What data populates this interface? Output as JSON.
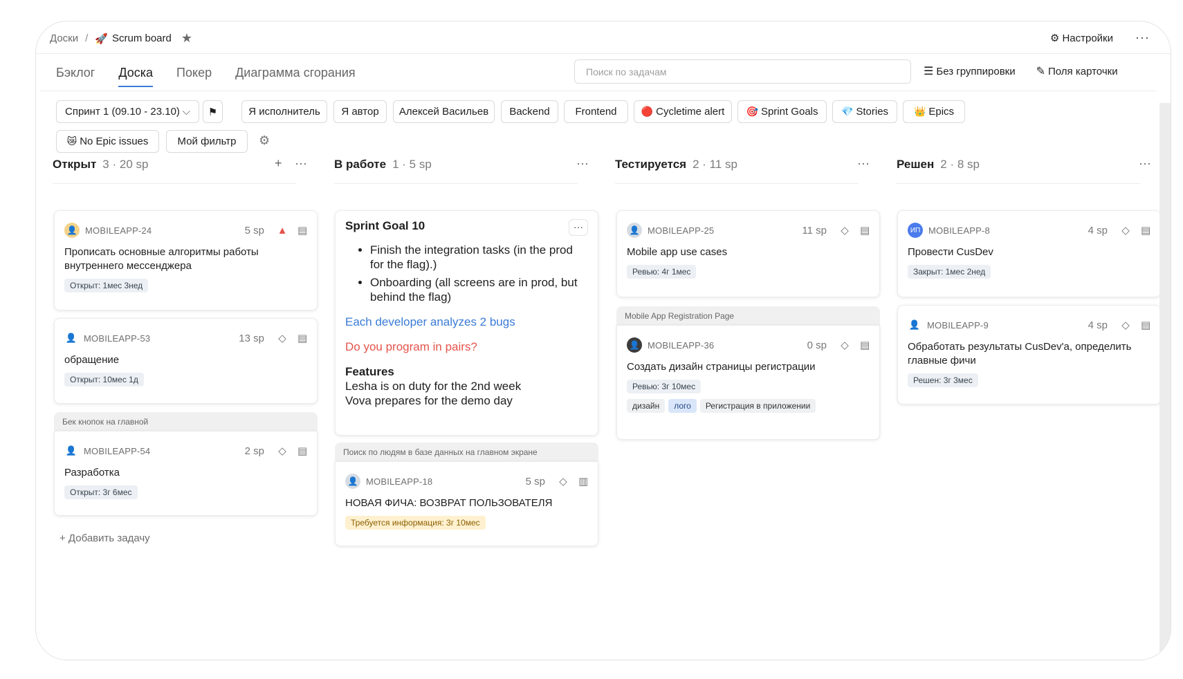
{
  "breadcrumb": {
    "root": "Доски",
    "separator": "/",
    "board_emoji": "🚀",
    "board_name": "Scrum board"
  },
  "header": {
    "settings_label": "Настройки",
    "more": "···"
  },
  "tabs": [
    {
      "label": "Бэклог",
      "active": false
    },
    {
      "label": "Доска",
      "active": true
    },
    {
      "label": "Покер",
      "active": false
    },
    {
      "label": "Диаграмма сгорания",
      "active": false
    }
  ],
  "search": {
    "placeholder": "Поиск по задачам"
  },
  "toolbar": {
    "grouping_label": "Без группировки",
    "card_fields_label": "Поля карточки"
  },
  "filters": {
    "sprint": "Спринт 1 (09.10 - 23.10)",
    "chips": [
      {
        "emoji": "",
        "label": "Я исполнитель"
      },
      {
        "emoji": "",
        "label": "Я автор"
      },
      {
        "emoji": "",
        "label": "Алексей Васильев"
      },
      {
        "emoji": "",
        "label": "Backend"
      },
      {
        "emoji": "",
        "label": "Frontend"
      },
      {
        "emoji": "🔴",
        "label": "Cycletime alert"
      },
      {
        "emoji": "🎯",
        "label": "Sprint Goals"
      },
      {
        "emoji": "💎",
        "label": "Stories"
      },
      {
        "emoji": "👑",
        "label": "Epics"
      },
      {
        "emoji": "😿",
        "label": "No Epic issues"
      },
      {
        "emoji": "",
        "label": "Мой фильтр"
      }
    ]
  },
  "columns": [
    {
      "title": "Открыт",
      "meta": "3 · 20 sp"
    },
    {
      "title": "В работе",
      "meta": "1 · 5 sp"
    },
    {
      "title": "Тестируется",
      "meta": "2 · 11 sp"
    },
    {
      "title": "Решен",
      "meta": "2 · 8 sp"
    }
  ],
  "cards": {
    "c24": {
      "key": "MOBILEAPP-24",
      "sp": "5 sp",
      "title": "Прописать основные алгоритмы работы внутреннего мессенджера",
      "badge": "Открыт: 1мес 3нед"
    },
    "c53": {
      "key": "MOBILEAPP-53",
      "sp": "13 sp",
      "title": "обращение",
      "badge": "Открыт: 10мес 1д"
    },
    "c54": {
      "group": "Бек кнопок на главной",
      "key": "MOBILEAPP-54",
      "sp": "2 sp",
      "title": "Разработка",
      "badge": "Открыт: 3г 6мес"
    },
    "c18": {
      "group": "Поиск по людям в базе данных на главном экране",
      "key": "MOBILEAPP-18",
      "sp": "5 sp",
      "title": "НОВАЯ ФИЧА: ВОЗВРАТ ПОЛЬЗОВАТЕЛЯ",
      "badge": "Требуется информация: 3г 10мес"
    },
    "c25": {
      "key": "MOBILEAPP-25",
      "sp": "11 sp",
      "title": "Mobile app use cases",
      "badge": "Ревью: 4г 1мес"
    },
    "c36": {
      "group": "Mobile App Registration Page",
      "key": "MOBILEAPP-36",
      "sp": "0 sp",
      "title": "Создать дизайн страницы регистрации",
      "badge": "Ревью: 3г 10мес",
      "tags": [
        "дизайн",
        "лого",
        "Регистрация в приложении"
      ]
    },
    "c8": {
      "key": "MOBILEAPP-8",
      "avatar": "ИП",
      "sp": "4 sp",
      "title": "Провести CusDev",
      "badge": "Закрыт: 1мес 2нед"
    },
    "c9": {
      "key": "MOBILEAPP-9",
      "sp": "4 sp",
      "title": "Обработать результаты CusDev'a, определить главные фичи",
      "badge": "Решен: 3г 3мес"
    }
  },
  "sprint_goal": {
    "title": "Sprint Goal 10",
    "bullets": [
      "Finish the integration tasks (in the prod for the flag).)",
      "Onboarding (all screens are in prod, but behind the flag)"
    ],
    "blue_line": "Each developer analyzes 2 bugs",
    "red_line": "Do you program in pairs?",
    "features_heading": "Features",
    "features": [
      "Lesha is on duty for the 2nd week",
      "Vova prepares for the demo day"
    ]
  },
  "add_task_label": "+ Добавить задачу",
  "colors": {
    "accent": "#3a7bd5",
    "danger": "#e4544c",
    "chip_border": "#d9d9d9"
  }
}
